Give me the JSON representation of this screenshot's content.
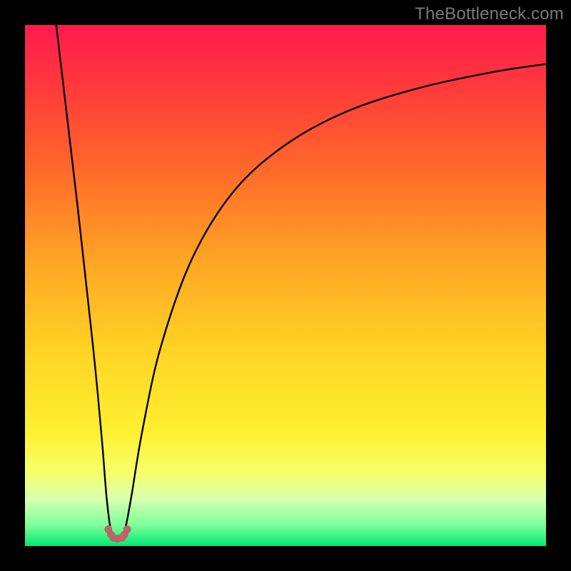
{
  "watermark": "TheBottleneck.com",
  "chart_data": {
    "type": "line",
    "title": "",
    "xlabel": "",
    "ylabel": "",
    "xlim": [
      0,
      100
    ],
    "ylim": [
      0,
      100
    ],
    "grid": false,
    "legend": false,
    "background_gradient": {
      "stops": [
        {
          "offset": 0.0,
          "color": "#ff1a4f"
        },
        {
          "offset": 0.12,
          "color": "#ff3a3a"
        },
        {
          "offset": 0.28,
          "color": "#ff6a2a"
        },
        {
          "offset": 0.45,
          "color": "#ffa424"
        },
        {
          "offset": 0.62,
          "color": "#ffd224"
        },
        {
          "offset": 0.78,
          "color": "#fff030"
        },
        {
          "offset": 0.86,
          "color": "#f6ff6a"
        },
        {
          "offset": 0.91,
          "color": "#d8ffb0"
        },
        {
          "offset": 0.96,
          "color": "#7dff9a"
        },
        {
          "offset": 1.0,
          "color": "#00e874"
        }
      ]
    },
    "series": [
      {
        "name": "left-branch",
        "x": [
          6.0,
          8.0,
          10.0,
          12.0,
          13.5,
          14.8,
          15.6,
          16.3,
          16.8
        ],
        "y": [
          100.0,
          83.0,
          66.0,
          48.0,
          34.0,
          20.0,
          10.0,
          4.0,
          2.0
        ]
      },
      {
        "name": "right-branch",
        "x": [
          18.8,
          19.4,
          20.5,
          22.5,
          26.0,
          32.0,
          40.0,
          50.0,
          62.0,
          76.0,
          90.0,
          100.0
        ],
        "y": [
          2.0,
          4.0,
          10.0,
          22.0,
          38.0,
          55.0,
          68.0,
          77.0,
          83.5,
          88.0,
          91.0,
          92.5
        ]
      }
    ],
    "cusp_markers": {
      "name": "cusp-dots",
      "color": "#bd6464",
      "points": [
        {
          "x": 16.0,
          "y": 3.2
        },
        {
          "x": 16.5,
          "y": 2.2
        },
        {
          "x": 17.0,
          "y": 1.6
        },
        {
          "x": 17.8,
          "y": 1.4
        },
        {
          "x": 18.6,
          "y": 1.6
        },
        {
          "x": 19.1,
          "y": 2.2
        },
        {
          "x": 19.6,
          "y": 3.2
        }
      ]
    }
  }
}
